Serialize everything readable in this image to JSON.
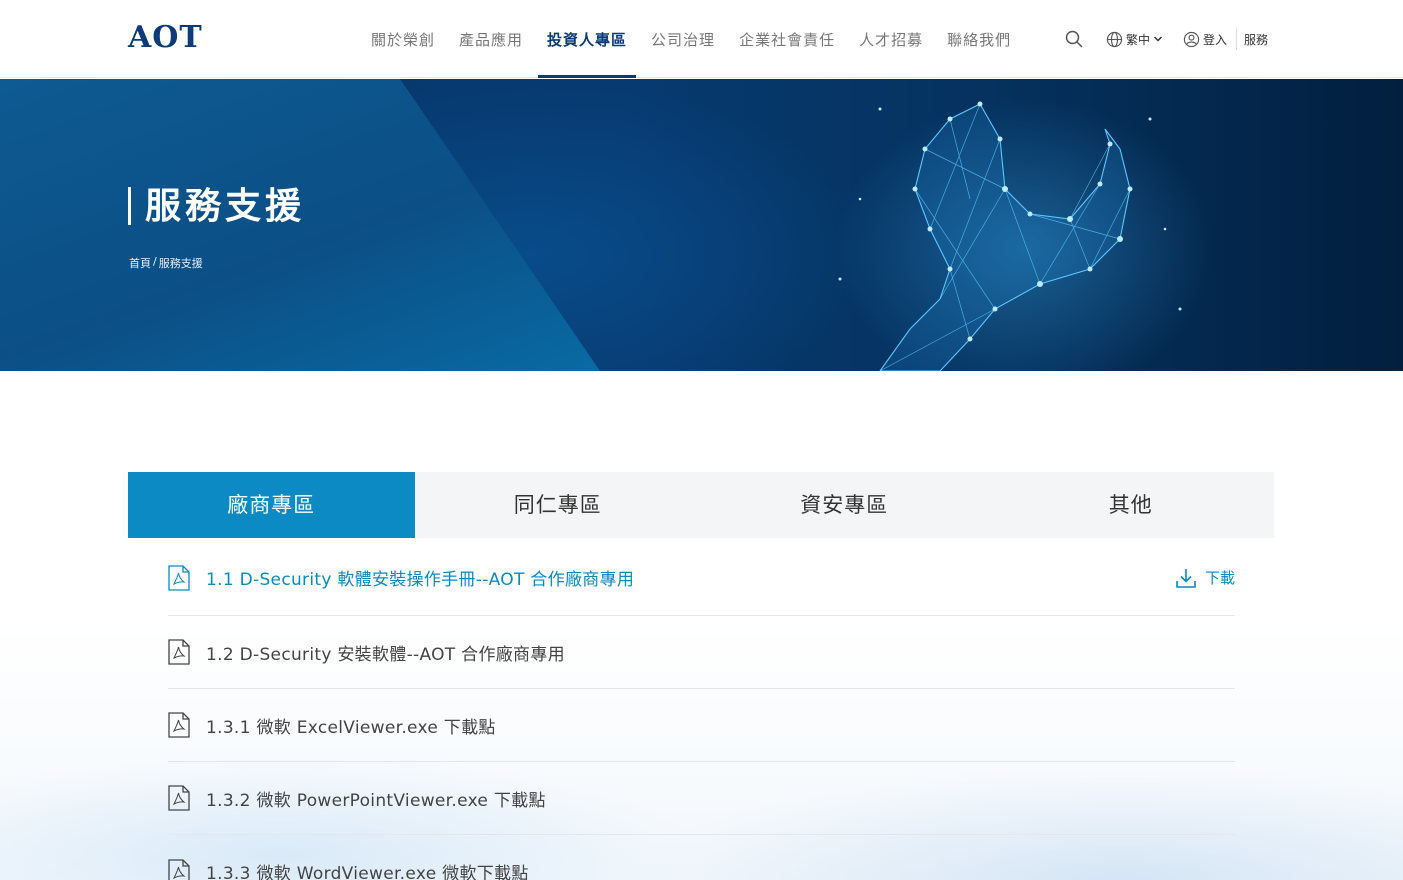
{
  "header": {
    "logo": "AOT",
    "nav": [
      {
        "label": "關於榮創",
        "active": false
      },
      {
        "label": "產品應用",
        "active": false
      },
      {
        "label": "投資人專區",
        "active": true
      },
      {
        "label": "公司治理",
        "active": false
      },
      {
        "label": "企業社會責任",
        "active": false
      },
      {
        "label": "人才招募",
        "active": false
      },
      {
        "label": "聯絡我們",
        "active": false
      }
    ],
    "language": "繁中",
    "login": "登入",
    "service": "服務"
  },
  "hero": {
    "title": "服務支援",
    "breadcrumb": [
      "首頁",
      "/",
      "服務支援"
    ]
  },
  "tabs": [
    {
      "label": "廠商專區",
      "active": true
    },
    {
      "label": "同仁專區",
      "active": false
    },
    {
      "label": "資安專區",
      "active": false
    },
    {
      "label": "其他",
      "active": false
    }
  ],
  "documents": [
    {
      "title": "1.1 D-Security 軟體安裝操作手冊--AOT 合作廠商專用",
      "highlight": true
    },
    {
      "title": "1.2 D-Security 安裝軟體--AOT 合作廠商專用",
      "highlight": false
    },
    {
      "title": "1.3.1 微軟 ExcelViewer.exe 下載點",
      "highlight": false
    },
    {
      "title": "1.3.2 微軟 PowerPointViewer.exe 下載點",
      "highlight": false
    },
    {
      "title": "1.3.3 微軟 WordViewer.exe 微軟下載點",
      "highlight": false
    }
  ],
  "download_label": "下載",
  "colors": {
    "brand_navy": "#0b3b7a",
    "accent_blue": "#0b8ac4",
    "hero_dark": "#05325f"
  }
}
